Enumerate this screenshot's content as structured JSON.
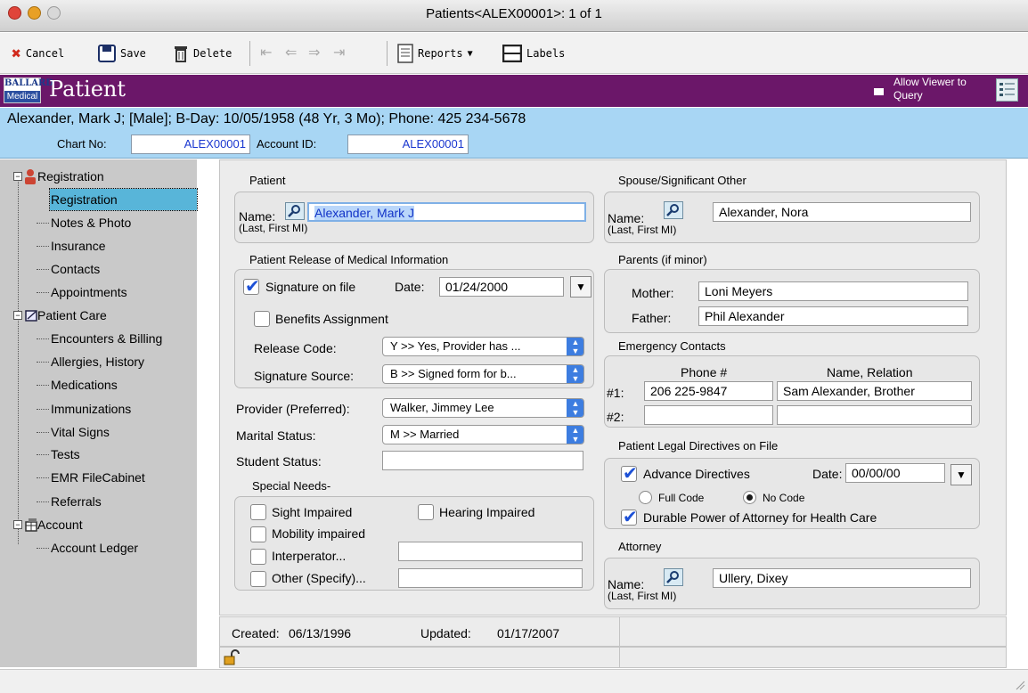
{
  "window": {
    "title": "Patients<ALEX00001>: 1 of 1",
    "colors": {
      "close": "#e0443a",
      "minimize": "#e8a025",
      "zoom": "#d8d8d8"
    }
  },
  "toolbar": {
    "cancel": "Cancel",
    "save": "Save",
    "delete": "Delete",
    "reports": "Reports",
    "labels": "Labels",
    "icons": [
      "cancel-x-icon",
      "save-disk-icon",
      "trash-icon",
      "first-record-icon",
      "prev-record-icon",
      "next-record-icon",
      "last-record-icon",
      "report-icon",
      "labels-icon"
    ]
  },
  "header": {
    "logo_top": "BALLARD",
    "logo_bottom": "Medical",
    "title": "Patient",
    "allow_query": "Allow Viewer to Query",
    "accent": "#6b1769"
  },
  "info": {
    "summary": "Alexander, Mark J; [Male]; B-Day: 10/05/1958 (48 Yr, 3 Mo); Phone: 425 234-5678",
    "chart_label": "Chart No:",
    "chart_value": "ALEX00001",
    "account_label": "Account ID:",
    "account_value": "ALEX00001",
    "band_color": "#a8d6f4"
  },
  "sidebar": {
    "registration": "Registration",
    "reg_items": [
      "Registration",
      "Notes & Photo",
      "Insurance",
      "Contacts",
      "Appointments"
    ],
    "patient_care": "Patient Care",
    "care_items": [
      "Encounters & Billing",
      "Allergies, History",
      "Medications",
      "Immunizations",
      "Vital Signs",
      "Tests",
      "EMR FileCabinet",
      "Referrals"
    ],
    "account": "Account",
    "account_items": [
      "Account Ledger"
    ],
    "selected_color": "#58b5d9"
  },
  "form": {
    "patient": {
      "group": "Patient",
      "name_label": "Name:",
      "name_hint": "(Last, First MI)",
      "name_value": "Alexander, Mark J"
    },
    "release": {
      "group": "Patient Release of Medical Information",
      "signature": "Signature on file",
      "date_label": "Date:",
      "date_value": "01/24/2000",
      "benefits": "Benefits Assignment",
      "release_code_label": "Release Code:",
      "release_code_value": "Y >> Yes, Provider has ...",
      "signature_source_label": "Signature Source:",
      "signature_source_value": "B >> Signed form for b..."
    },
    "provider_label": "Provider (Preferred):",
    "provider_value": "Walker, Jimmey Lee",
    "marital_label": "Marital Status:",
    "marital_value": "M >> Married",
    "student_label": "Student Status:",
    "student_value": "",
    "special": {
      "group": "Special Needs-",
      "sight": "Sight Impaired",
      "hearing": "Hearing Impaired",
      "mobility": "Mobility impaired",
      "interp": "Interperator...",
      "other": "Other (Specify)...",
      "interp_value": "",
      "other_value": ""
    },
    "spouse": {
      "group": "Spouse/Significant Other",
      "name_label": "Name:",
      "name_hint": "(Last, First MI)",
      "name_value": "Alexander, Nora"
    },
    "parents": {
      "group": "Parents (if minor)",
      "mother_label": "Mother:",
      "mother_value": "Loni Meyers",
      "father_label": "Father:",
      "father_value": "Phil Alexander"
    },
    "emergency": {
      "group": "Emergency Contacts",
      "phone_header": "Phone #",
      "name_header": "Name, Relation",
      "row1_label": "#1:",
      "row1_phone": "206 225-9847",
      "row1_name": "Sam Alexander, Brother",
      "row2_label": "#2:",
      "row2_phone": "",
      "row2_name": ""
    },
    "legal": {
      "group": "Patient Legal Directives on File",
      "advance": "Advance Directives",
      "date_label": "Date:",
      "date_value": "00/00/00",
      "full_code": "Full Code",
      "no_code": "No Code",
      "poa": "Durable Power of Attorney for Health Care"
    },
    "attorney": {
      "group": "Attorney",
      "name_label": "Name:",
      "name_hint": "(Last, First MI)",
      "name_value": "Ullery, Dixey"
    }
  },
  "footer": {
    "created_label": "Created:",
    "created_value": "06/13/1996",
    "updated_label": "Updated:",
    "updated_value": "01/17/2007"
  }
}
